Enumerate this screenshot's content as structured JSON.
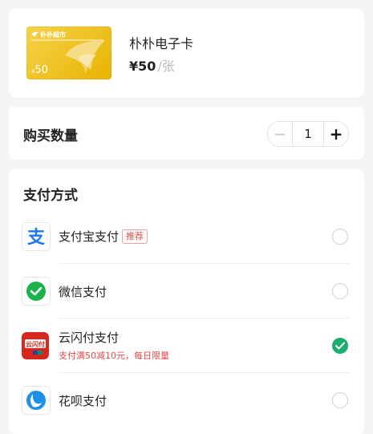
{
  "product": {
    "card_brand": "朴朴超市",
    "card_value": "50",
    "card_currency": "¥",
    "name": "朴朴电子卡",
    "price": "¥50",
    "unit": "/张"
  },
  "quantity": {
    "label": "购买数量",
    "minus": "−",
    "value": "1",
    "plus": "+"
  },
  "payment": {
    "title": "支付方式",
    "methods": [
      {
        "name": "支付宝支付",
        "badge": "推荐",
        "promo": "",
        "selected": false,
        "icon": "alipay-icon"
      },
      {
        "name": "微信支付",
        "badge": "",
        "promo": "",
        "selected": false,
        "icon": "wechat-pay-icon"
      },
      {
        "name": "云闪付支付",
        "badge": "",
        "promo": "支付满50减10元，每日限量",
        "selected": true,
        "icon": "unionpay-quickpass-icon"
      },
      {
        "name": "花呗支付",
        "badge": "",
        "promo": "",
        "selected": false,
        "icon": "huabei-icon"
      }
    ]
  },
  "colors": {
    "accent_green": "#1aad6e",
    "promo_red": "#e04a4a",
    "gift_card_gold": "#f0c21c"
  }
}
